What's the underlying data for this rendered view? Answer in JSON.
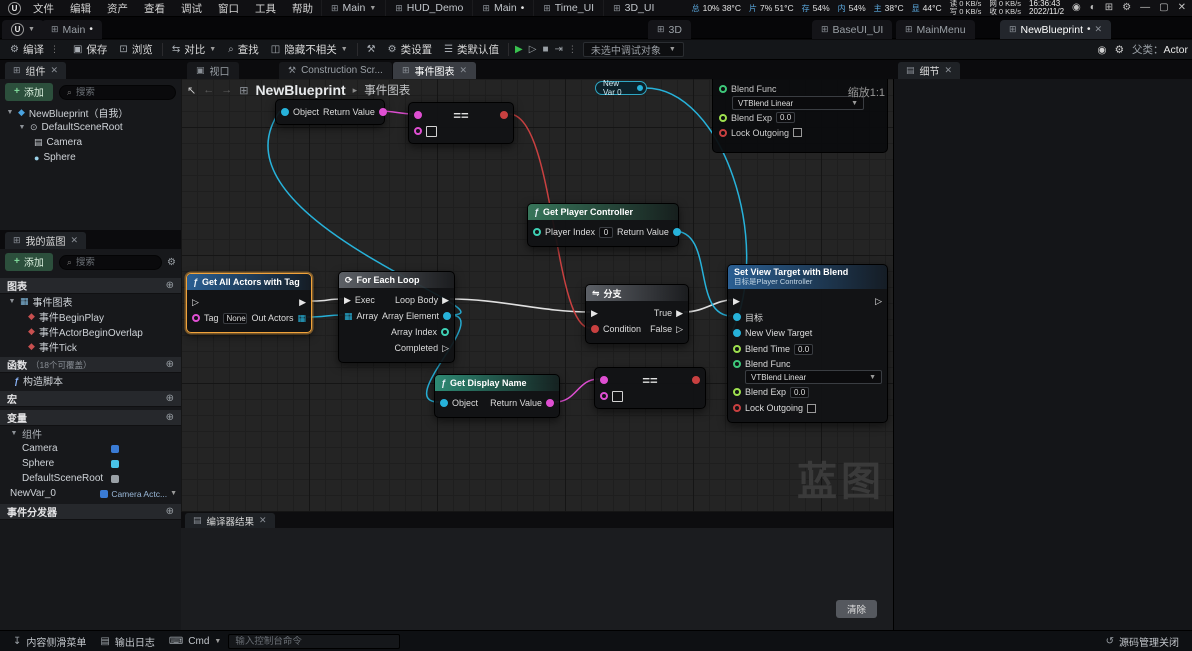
{
  "window": {
    "menus": [
      "文件",
      "编辑",
      "资产",
      "查看",
      "调试",
      "窗口",
      "工具",
      "帮助"
    ],
    "app_tab": "Main",
    "doc_tabs": [
      "HUD_Demo",
      "Main",
      "Time_UI",
      "3D_UI"
    ],
    "stats": [
      {
        "label": "总",
        "value": "10% 38°C"
      },
      {
        "label": "片",
        "value": "7% 51°C"
      },
      {
        "label": "存",
        "value": "54%"
      },
      {
        "label": "内",
        "value": "54%"
      },
      {
        "label": "主",
        "value": "38°C"
      },
      {
        "label": "显",
        "value": "44°C"
      }
    ],
    "io": [
      {
        "a": "读 0 KB/s",
        "b": "写 0 KB/s"
      },
      {
        "a": "网 0 KB/s",
        "b": "收 0 KB/s"
      }
    ],
    "time": "16:36:43",
    "date": "2022/11/2"
  },
  "tabs2": {
    "main": "Main",
    "t3d": "3D",
    "base": "BaseUI_UI",
    "menu": "MainMenu",
    "active": "NewBlueprint"
  },
  "toolbar": {
    "compile": "编译",
    "save": "保存",
    "browse": "浏览",
    "diff": "对比",
    "find": "查找",
    "hide_unrelated": "隐藏不相关",
    "class_settings": "类设置",
    "class_defaults": "类默认值",
    "debug_object": "未选中调试对象",
    "parent_label": "父类：",
    "parent_value": "Actor"
  },
  "components": {
    "tab": "组件",
    "add": "添加",
    "search": "搜索",
    "root": "NewBlueprint（自我）",
    "scene_root": "DefaultSceneRoot",
    "camera": "Camera",
    "sphere": "Sphere"
  },
  "myblueprint": {
    "tab": "我的蓝图",
    "add": "添加",
    "search": "搜索",
    "graphs": "图表",
    "event_graph": "事件图表",
    "ev1": "事件BeginPlay",
    "ev2": "事件ActorBeginOverlap",
    "ev3": "事件Tick",
    "functions": "函数",
    "functions_hint": "（18个可覆盖）",
    "construction": "构造脚本",
    "macros": "宏",
    "variables": "变量",
    "components_cat": "组件",
    "var_camera": "Camera",
    "var_sphere": "Sphere",
    "var_root": "DefaultSceneRoot",
    "new_var": "NewVar_0",
    "new_var_type": "Camera Actc...",
    "dispatchers": "事件分发器"
  },
  "graph": {
    "tab_viewport": "视口",
    "tab_construction": "Construction Scr...",
    "tab_event": "事件图表",
    "crumb_root": "NewBlueprint",
    "crumb_current": "事件图表",
    "zoom": "缩放1:1",
    "watermark": "蓝图",
    "compiler_tab": "编译器结果",
    "clear": "清除"
  },
  "nodes": {
    "get_display_name_top": {
      "object": "Object",
      "return_value": "Return Value"
    },
    "equal_top": {
      "op": "=="
    },
    "new_var_get": {
      "label": "New Var 0"
    },
    "blend_overlay": {
      "blend_func": "Blend Func",
      "blend_func_value": "VTBlend Linear",
      "blend_exp": "Blend Exp",
      "blend_exp_value": "0.0",
      "lock_outgoing": "Lock Outgoing"
    },
    "get_player_controller": {
      "title": "Get Player Controller",
      "player_index": "Player Index",
      "player_index_value": "0",
      "return_value": "Return Value"
    },
    "get_all_actors_with_tag": {
      "title": "Get All Actors with Tag",
      "tag": "Tag",
      "tag_value": "None",
      "out_actors": "Out Actors"
    },
    "for_each_loop": {
      "title": "For Each Loop",
      "exec": "Exec",
      "array": "Array",
      "loop_body": "Loop Body",
      "array_element": "Array Element",
      "array_index": "Array Index",
      "completed": "Completed"
    },
    "branch": {
      "title": "分支",
      "condition": "Condition",
      "true_label": "True",
      "false_label": "False"
    },
    "set_view_target": {
      "title": "Set View Target with Blend",
      "subtitle": "目标是Player Controller",
      "target": "目标",
      "new_view_target": "New View Target",
      "blend_time": "Blend Time",
      "blend_time_value": "0.0",
      "blend_func": "Blend Func",
      "blend_func_value": "VTBlend Linear",
      "blend_exp": "Blend Exp",
      "blend_exp_value": "0.0",
      "lock_outgoing": "Lock Outgoing"
    },
    "get_display_name": {
      "title": "Get Display Name",
      "object": "Object",
      "return_value": "Return Value"
    },
    "equal_bottom": {
      "op": "=="
    }
  },
  "details": {
    "tab": "细节"
  },
  "statusbar": {
    "drawer": "内容侧滑菜单",
    "log": "输出日志",
    "cmd": "Cmd",
    "console_placeholder": "输入控制台命令",
    "source": "源码管理关闭"
  },
  "colors": {
    "exec_wire": "#e0e0e0",
    "object_wire": "#27b2da",
    "string_wire": "#df4fd2",
    "bool_wire": "#c84040",
    "selected_node": "#f0a33c"
  }
}
